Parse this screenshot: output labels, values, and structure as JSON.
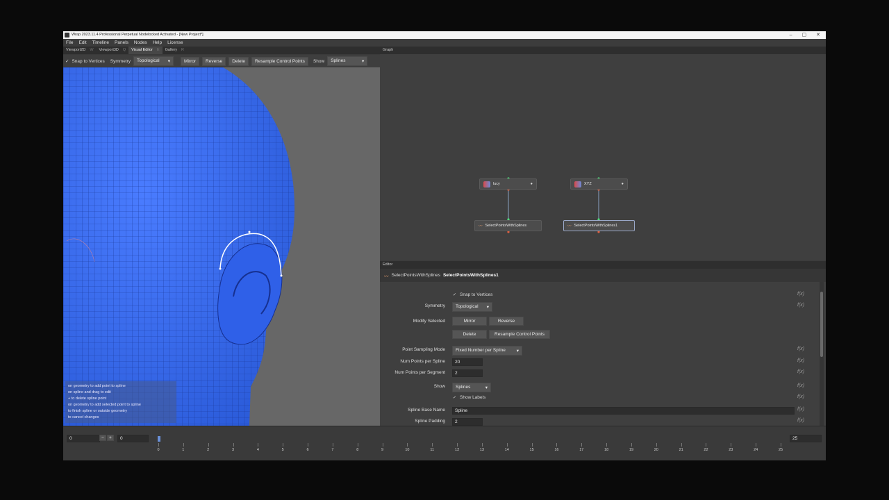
{
  "window": {
    "title": "Wrap 2023.11.4  Professional Perpetual Nodelocked Activated - [New Project*]",
    "controls": [
      "–",
      "▢",
      "✕"
    ]
  },
  "menu": [
    "File",
    "Edit",
    "Timeline",
    "Panels",
    "Nodes",
    "Help",
    "License"
  ],
  "tabs": [
    {
      "label": "Viewport2D",
      "key": "W"
    },
    {
      "label": "Viewport3D",
      "key": "Q"
    },
    {
      "label": "Visual Editor",
      "key": "E"
    },
    {
      "label": "Gallery",
      "key": "R"
    }
  ],
  "toolbar": {
    "snap_label": "Snap to Vertices",
    "symmetry_label": "Symmetry",
    "symmetry_value": "Topological",
    "mirror": "Mirror",
    "reverse": "Reverse",
    "delete": "Delete",
    "resample": "Resample Control Points",
    "show_label": "Show",
    "show_value": "Splines"
  },
  "hints": [
    "on geometry to add point to spline",
    "on spline and drag to edit",
    "+ to delete spline point",
    "on geometry to add selected point to spline",
    "to finish spline or outside geometry",
    "to cancel changes"
  ],
  "graph": {
    "header": "Graph",
    "nodes": {
      "lucy": "lucy",
      "xyz": "XYZ",
      "select1": "SelectPointsWithSplines",
      "select2": "SelectPointsWithSplines1"
    }
  },
  "editor": {
    "header": "Editor",
    "node_type": "SelectPointsWithSplines",
    "node_name": "SelectPointsWithSplines1",
    "snap_label": "Snap to Vertices",
    "symmetry_label": "Symmetry",
    "symmetry_value": "Topological",
    "modify_label": "Modify Selected",
    "mirror": "Mirror",
    "reverse": "Reverse",
    "delete": "Delete",
    "resample": "Resample Control Points",
    "sampling_label": "Point Sampling Mode",
    "sampling_value": "Fixed Number per Spline",
    "num_spline_label": "Num Points per Spline",
    "num_spline_value": "20",
    "num_segment_label": "Num Points per Segment",
    "num_segment_value": "2",
    "show_label": "Show",
    "show_value": "Splines",
    "show_labels_label": "Show Labels",
    "base_name_label": "Spline Base Name",
    "base_name_value": "Spline",
    "padding_label": "Spline Padding",
    "padding_value": "2",
    "fx": "f(x)"
  },
  "timeline": {
    "start": "0",
    "current": "0",
    "end": "25",
    "ticks": [
      "0",
      "1",
      "2",
      "3",
      "4",
      "5",
      "6",
      "7",
      "8",
      "9",
      "10",
      "11",
      "12",
      "13",
      "14",
      "15",
      "16",
      "17",
      "18",
      "19",
      "20",
      "21",
      "22",
      "23",
      "24",
      "25"
    ]
  },
  "colors": {
    "mesh": "#3a6cf0",
    "spline": "#ffffff"
  }
}
